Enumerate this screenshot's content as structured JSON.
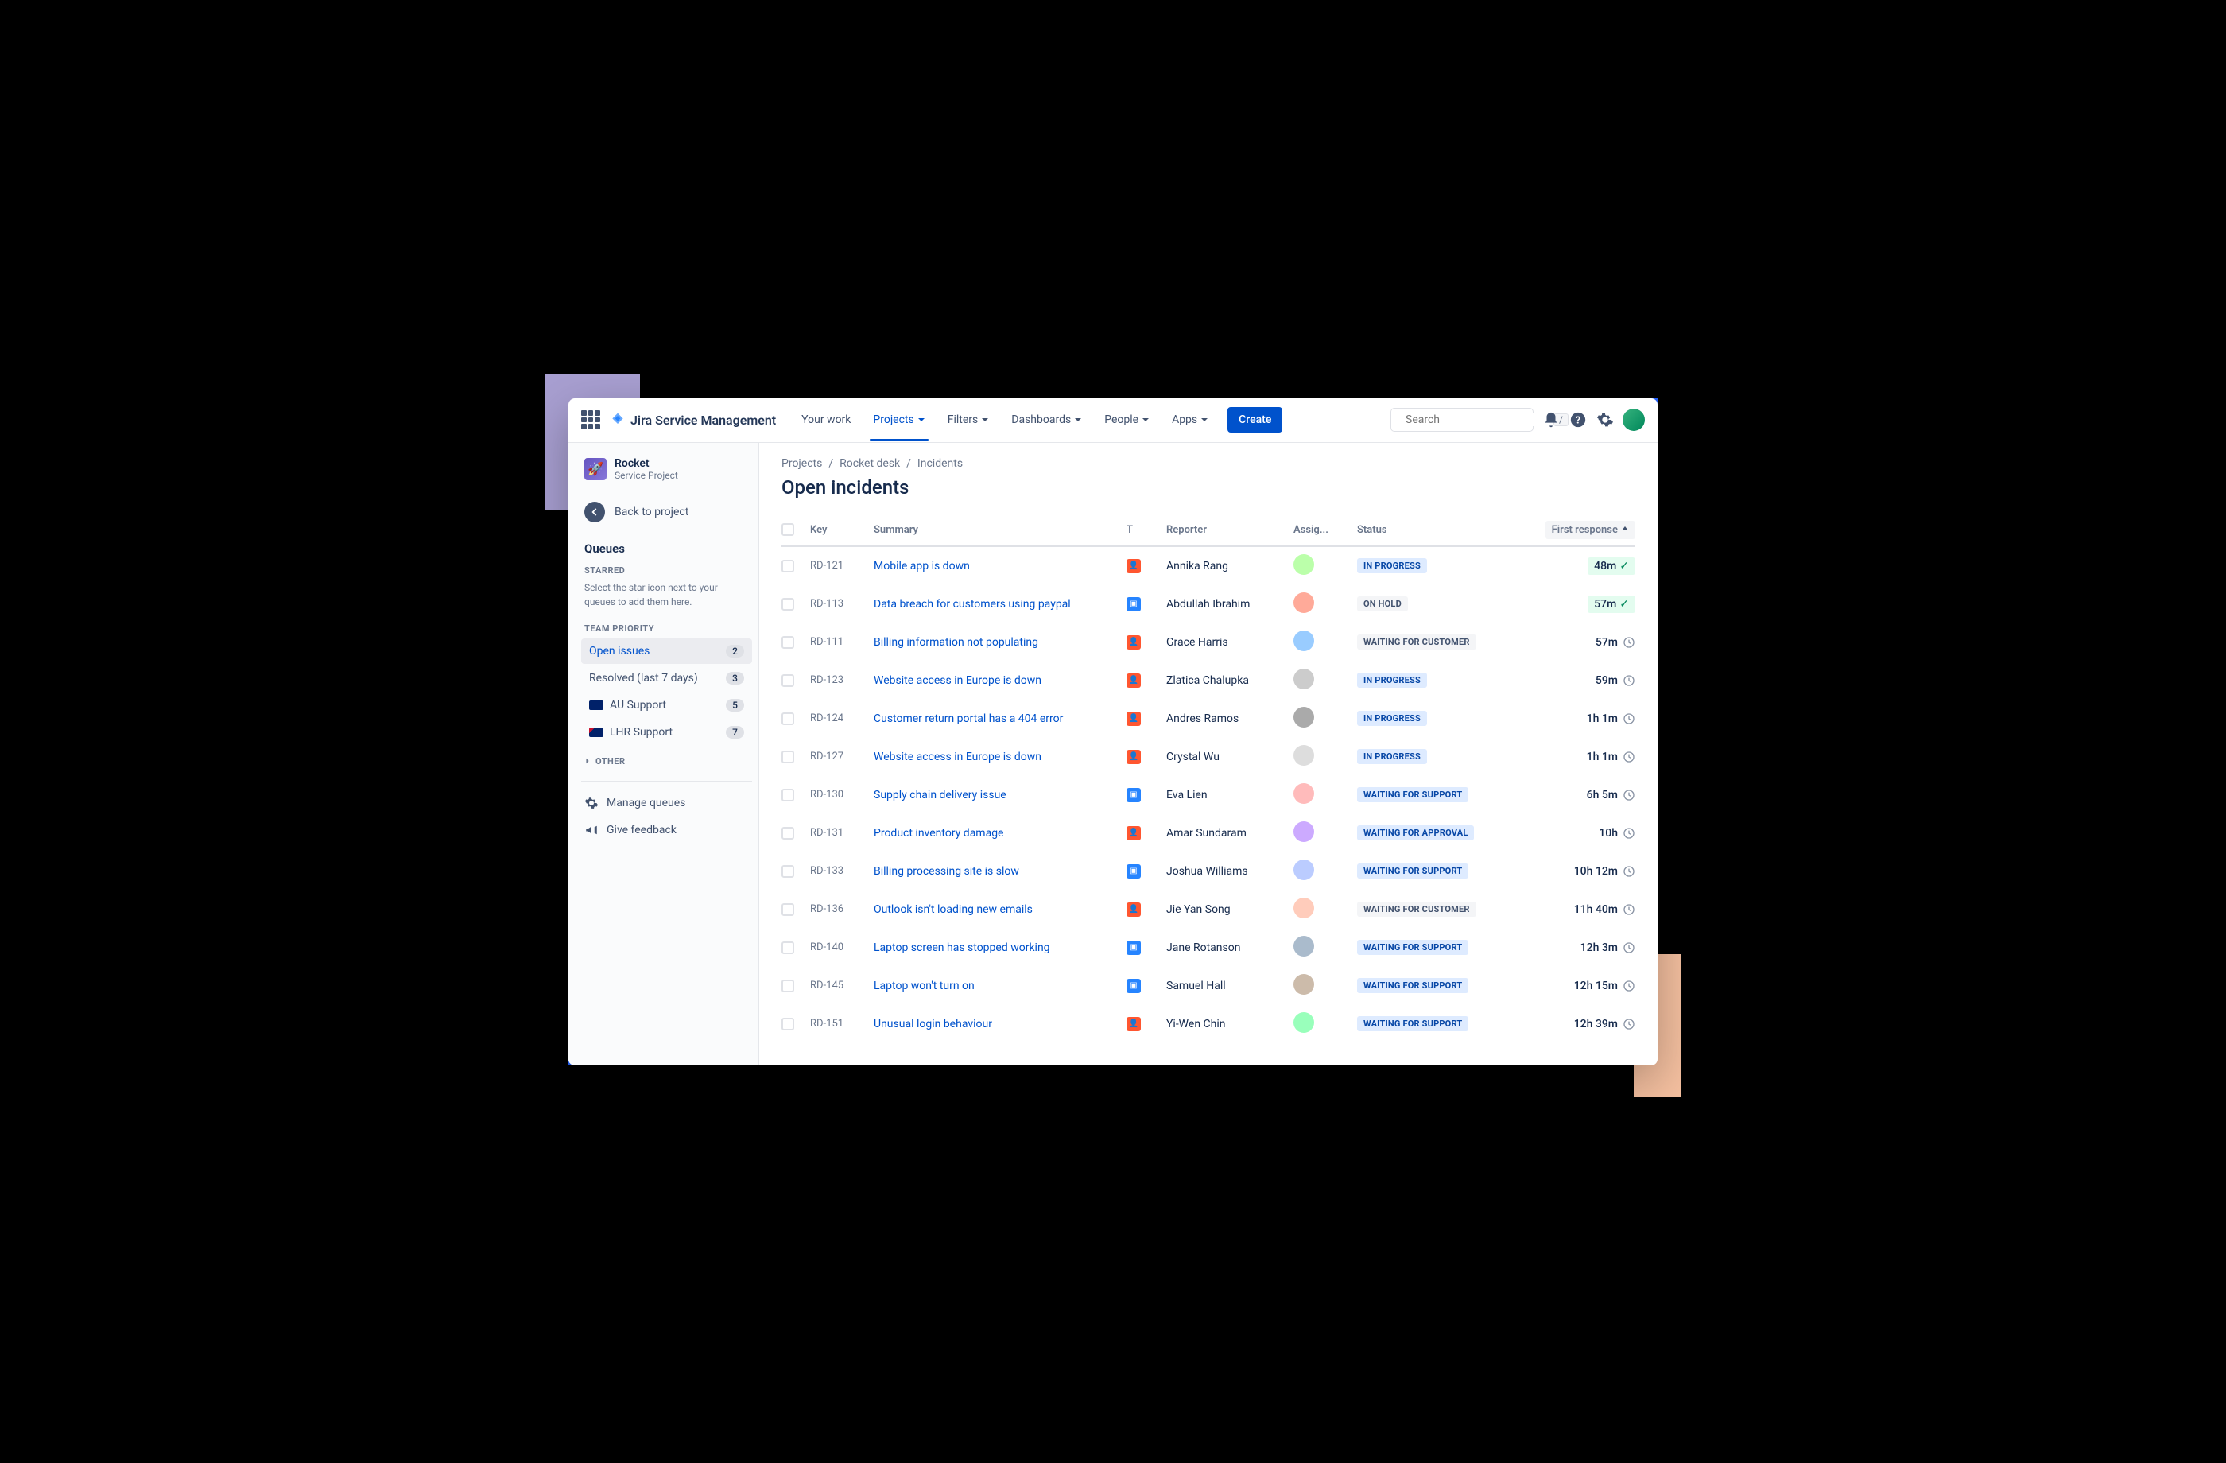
{
  "brand": "Jira Service Management",
  "nav": {
    "your_work": "Your work",
    "projects": "Projects",
    "filters": "Filters",
    "dashboards": "Dashboards",
    "people": "People",
    "apps": "Apps",
    "create": "Create"
  },
  "search": {
    "placeholder": "Search",
    "hint": "/"
  },
  "project": {
    "name": "Rocket",
    "type": "Service Project"
  },
  "back_label": "Back to project",
  "queues_title": "Queues",
  "starred_label": "STARRED",
  "starred_hint": "Select the star icon next to your queues to add them here.",
  "team_priority_label": "TEAM PRIORITY",
  "queues": [
    {
      "label": "Open issues",
      "count": "2",
      "active": true
    },
    {
      "label": "Resolved (last 7 days)",
      "count": "3"
    },
    {
      "label": "AU Support",
      "count": "5",
      "flag": "au"
    },
    {
      "label": "LHR Support",
      "count": "7",
      "flag": "uk"
    }
  ],
  "other_label": "OTHER",
  "manage_queues": "Manage queues",
  "give_feedback": "Give feedback",
  "breadcrumbs": [
    "Projects",
    "Rocket desk",
    "Incidents"
  ],
  "page_title": "Open incidents",
  "columns": {
    "key": "Key",
    "summary": "Summary",
    "type": "T",
    "reporter": "Reporter",
    "assignee": "Assig...",
    "status": "Status",
    "first_response": "First response"
  },
  "rows": [
    {
      "key": "RD-121",
      "summary": "Mobile app is down",
      "type": "orange",
      "reporter": "Annika Rang",
      "status": "IN PROGRESS",
      "status_class": "inprogress",
      "response": "48m",
      "response_ok": true
    },
    {
      "key": "RD-113",
      "summary": "Data breach for customers using paypal",
      "type": "blue",
      "reporter": "Abdullah Ibrahim",
      "status": "ON HOLD",
      "status_class": "onhold",
      "response": "57m",
      "response_ok": true
    },
    {
      "key": "RD-111",
      "summary": "Billing information not populating",
      "type": "orange",
      "reporter": "Grace Harris",
      "status": "WAITING FOR CUSTOMER",
      "status_class": "waiting-customer",
      "response": "57m",
      "response_ok": false
    },
    {
      "key": "RD-123",
      "summary": "Website access in Europe is down",
      "type": "orange",
      "reporter": "Zlatica Chalupka",
      "status": "IN PROGRESS",
      "status_class": "inprogress",
      "response": "59m",
      "response_ok": false
    },
    {
      "key": "RD-124",
      "summary": "Customer return portal has a 404 error",
      "type": "orange",
      "reporter": "Andres Ramos",
      "status": "IN PROGRESS",
      "status_class": "inprogress",
      "response": "1h 1m",
      "response_ok": false
    },
    {
      "key": "RD-127",
      "summary": "Website access in Europe is down",
      "type": "orange",
      "reporter": "Crystal Wu",
      "status": "IN PROGRESS",
      "status_class": "inprogress",
      "response": "1h 1m",
      "response_ok": false
    },
    {
      "key": "RD-130",
      "summary": "Supply chain delivery issue",
      "type": "blue",
      "reporter": "Eva Lien",
      "status": "WAITING FOR SUPPORT",
      "status_class": "waiting-support",
      "response": "6h 5m",
      "response_ok": false
    },
    {
      "key": "RD-131",
      "summary": "Product inventory damage",
      "type": "orange",
      "reporter": "Amar Sundaram",
      "status": "WAITING FOR APPROVAL",
      "status_class": "waiting-approval",
      "response": "10h",
      "response_ok": false
    },
    {
      "key": "RD-133",
      "summary": "Billing processing site is slow",
      "type": "blue",
      "reporter": "Joshua Williams",
      "status": "WAITING FOR SUPPORT",
      "status_class": "waiting-support",
      "response": "10h 12m",
      "response_ok": false
    },
    {
      "key": "RD-136",
      "summary": "Outlook isn't loading new emails",
      "type": "orange",
      "reporter": "Jie Yan Song",
      "status": "WAITING FOR CUSTOMER",
      "status_class": "waiting-customer",
      "response": "11h 40m",
      "response_ok": false
    },
    {
      "key": "RD-140",
      "summary": "Laptop screen has stopped working",
      "type": "blue",
      "reporter": "Jane Rotanson",
      "status": "WAITING FOR SUPPORT",
      "status_class": "waiting-support",
      "response": "12h 3m",
      "response_ok": false
    },
    {
      "key": "RD-145",
      "summary": "Laptop won't turn on",
      "type": "blue",
      "reporter": "Samuel Hall",
      "status": "WAITING FOR SUPPORT",
      "status_class": "waiting-support",
      "response": "12h 15m",
      "response_ok": false
    },
    {
      "key": "RD-151",
      "summary": "Unusual login behaviour",
      "type": "orange",
      "reporter": "Yi-Wen Chin",
      "status": "WAITING FOR SUPPORT",
      "status_class": "waiting-support",
      "response": "12h 39m",
      "response_ok": false
    }
  ]
}
